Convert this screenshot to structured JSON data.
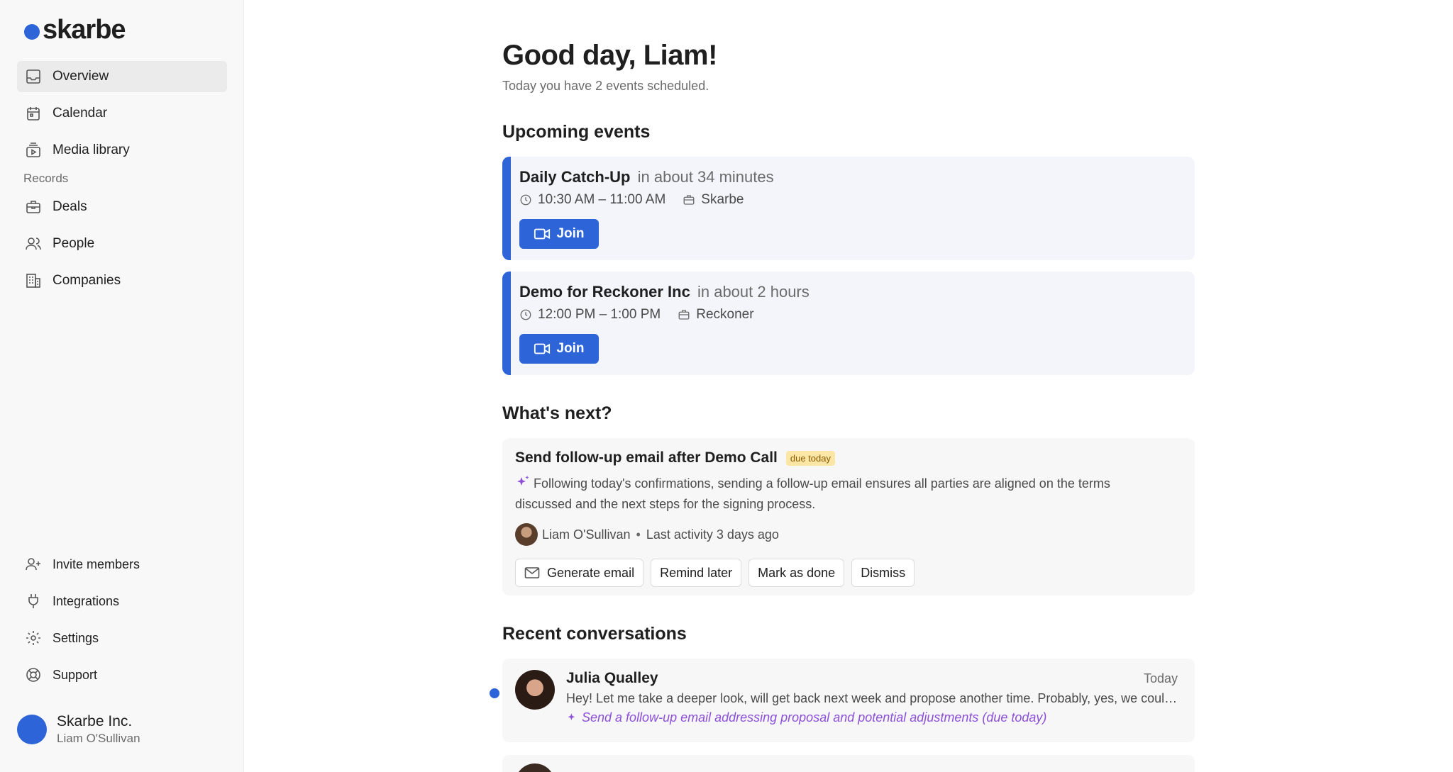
{
  "brand": {
    "name": "skarbe",
    "accent": "#2d64d8"
  },
  "sidebar": {
    "main_items": [
      {
        "label": "Overview",
        "icon": "inbox-icon",
        "active": true
      },
      {
        "label": "Calendar",
        "icon": "calendar-icon"
      },
      {
        "label": "Media library",
        "icon": "media-library-icon"
      }
    ],
    "records_label": "Records",
    "record_items": [
      {
        "label": "Deals",
        "icon": "briefcase-icon"
      },
      {
        "label": "People",
        "icon": "people-icon"
      },
      {
        "label": "Companies",
        "icon": "building-icon"
      }
    ],
    "bottom_items": [
      {
        "label": "Invite members",
        "icon": "user-plus-icon"
      },
      {
        "label": "Integrations",
        "icon": "plug-icon"
      },
      {
        "label": "Settings",
        "icon": "gear-icon"
      },
      {
        "label": "Support",
        "icon": "lifebuoy-icon"
      }
    ],
    "account": {
      "org": "Skarbe Inc.",
      "user": "Liam O'Sullivan"
    }
  },
  "header": {
    "greeting": "Good day, Liam!",
    "subtitle": "Today you have 2 events scheduled."
  },
  "upcoming": {
    "title": "Upcoming events",
    "events": [
      {
        "title": "Daily Catch-Up",
        "relative": "in about 34 minutes",
        "time": "10:30 AM – 11:00 AM",
        "company": "Skarbe",
        "join_label": "Join"
      },
      {
        "title": "Demo for Reckoner Inc",
        "relative": "in about 2 hours",
        "time": "12:00 PM – 1:00 PM",
        "company": "Reckoner",
        "join_label": "Join"
      }
    ]
  },
  "next": {
    "title": "What's next?",
    "task": {
      "title": "Send follow-up email after Demo Call",
      "badge": "due today",
      "description": "Following today's confirmations, sending a follow-up email ensures all parties are aligned on the terms discussed and the next steps for the signing process.",
      "owner": "Liam O'Sullivan",
      "activity": "Last activity 3 days ago",
      "actions": {
        "generate": "Generate email",
        "remind": "Remind later",
        "done": "Mark as done",
        "dismiss": "Dismiss"
      }
    }
  },
  "recent": {
    "title": "Recent conversations",
    "conversations": [
      {
        "name": "Julia Qualley",
        "time": "Today",
        "message": "Hey! Let me take a deeper look, will get back next week and propose another time. Probably, yes, we could do a call early next week to go over the details.",
        "suggestion": "Send a follow-up email addressing proposal and potential adjustments (due today)"
      }
    ]
  }
}
